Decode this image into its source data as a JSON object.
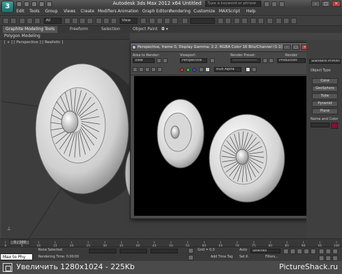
{
  "titlebar": {
    "app_title": "Autodesk 3ds Max  2012 x64     Untitled",
    "search_placeholder": "Type a keyword or phrase",
    "minimize": "–",
    "maximize": "□",
    "close": "✕"
  },
  "menu": {
    "items": [
      "Edit",
      "Tools",
      "Group",
      "Views",
      "Create",
      "Modifiers",
      "Animation",
      "Graph Editors",
      "Rendering",
      "Customize",
      "MAXScript",
      "Help"
    ]
  },
  "toolbar": {
    "selection_filter": "All",
    "coord_system": "View"
  },
  "ribbon": {
    "tabs": [
      "Graphite Modeling Tools",
      "Freeform",
      "Selection",
      "Object Paint"
    ],
    "sub_label": "Polygon Modeling"
  },
  "viewport": {
    "label": "[ + ] [ Perspective ] [ Realistic ]"
  },
  "render_window": {
    "title": "Perspective, frame 0, Display Gamma: 2.2, RGBA Color 16 Bits/Channel (1:1)",
    "area_label": "Area to Render:",
    "area_value": "View",
    "viewport_label": "Viewport:",
    "viewport_value": "Perspective",
    "preset_label": "Render Preset:",
    "preset_value": "--------------------",
    "render_label": "Render",
    "render_value": "Production",
    "channel_value": "RGB Alpha"
  },
  "command_panel": {
    "dropdown": "Standard Primitives",
    "section_label": "Object Type",
    "buttons": [
      "Cone",
      "GeoSphere",
      "Tube",
      "Pyramid",
      "Plane"
    ],
    "color_label": "Name and Color",
    "swatch_color": "#8a1030"
  },
  "timeline": {
    "frame_display": "0 / 100",
    "ticks": [
      "0",
      "5",
      "10",
      "15",
      "20",
      "25",
      "30",
      "35",
      "40",
      "45",
      "50",
      "55",
      "60",
      "65",
      "70",
      "75",
      "80",
      "85",
      "90",
      "95",
      "100"
    ]
  },
  "status": {
    "maxscript": "Max to Phy",
    "none_selected": "None Selected",
    "rendering_time": "Rendering Time: 0:00:00",
    "grid": "Grid = 0.0",
    "auto_key": "Auto",
    "selected": "Selected",
    "set_key": "Set K.",
    "filters": "Filters...",
    "add_time_tag": "Add Time Tag"
  },
  "watermark": {
    "left": "Увеличить   1280x1024 - 225Kb",
    "right": "PictureShack.ru"
  }
}
